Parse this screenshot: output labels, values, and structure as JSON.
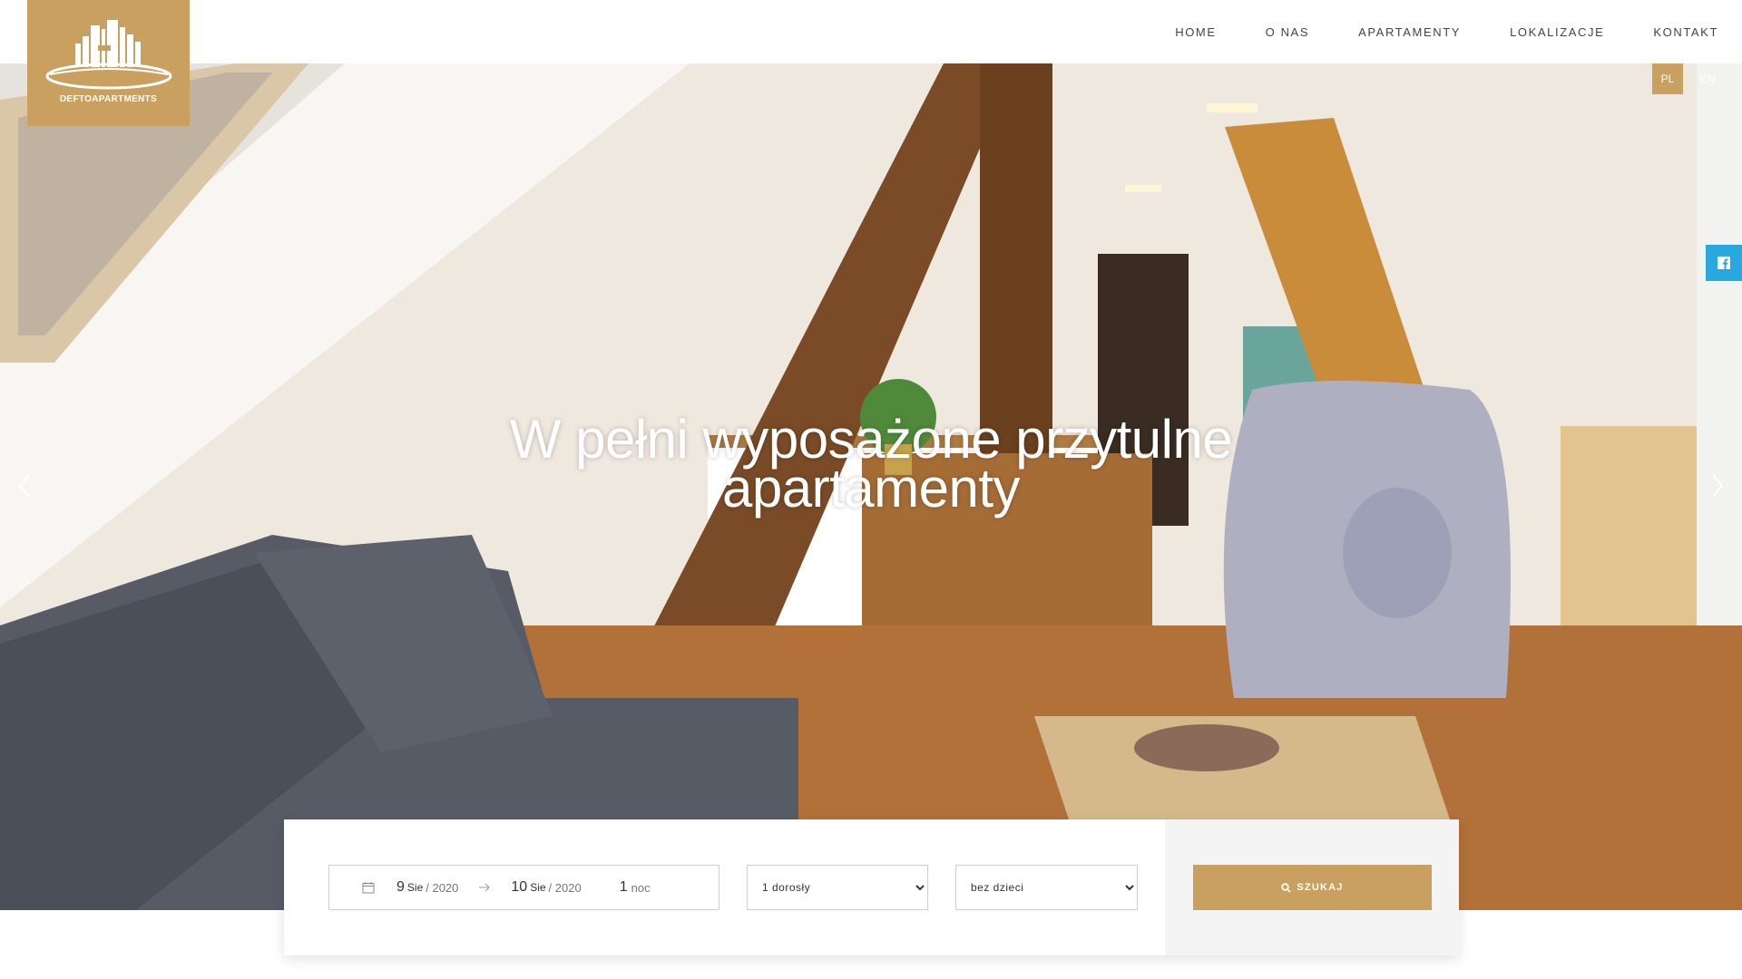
{
  "brand": {
    "name": "DEFTOAPARTMENTS",
    "accent_color": "#c9a060"
  },
  "nav": {
    "items": [
      {
        "label": "HOME"
      },
      {
        "label": "O NAS"
      },
      {
        "label": "APARTAMENTY"
      },
      {
        "label": "LOKALIZACJE"
      },
      {
        "label": "KONTAKT"
      }
    ]
  },
  "lang": {
    "pl": "PL",
    "en": "EN",
    "active": "PL"
  },
  "hero": {
    "title": "W pełni wyposażone przytulne apartamenty",
    "prev_icon": "chevron-left-icon",
    "next_icon": "chevron-right-icon"
  },
  "social": {
    "icon": "facebook-icon",
    "color": "#29a8e0"
  },
  "booking": {
    "checkin": {
      "day": "9",
      "month": "Sie",
      "year": "/ 2020"
    },
    "checkout": {
      "day": "10",
      "month": "Sie",
      "year": "/ 2020"
    },
    "nights": {
      "count": "1",
      "label": "noc"
    },
    "adults": {
      "selected": "1 dorosły",
      "options": [
        "1 dorosły"
      ]
    },
    "children": {
      "selected": "bez dzieci",
      "options": [
        "bez dzieci"
      ]
    },
    "search_label": "SZUKAJ"
  }
}
